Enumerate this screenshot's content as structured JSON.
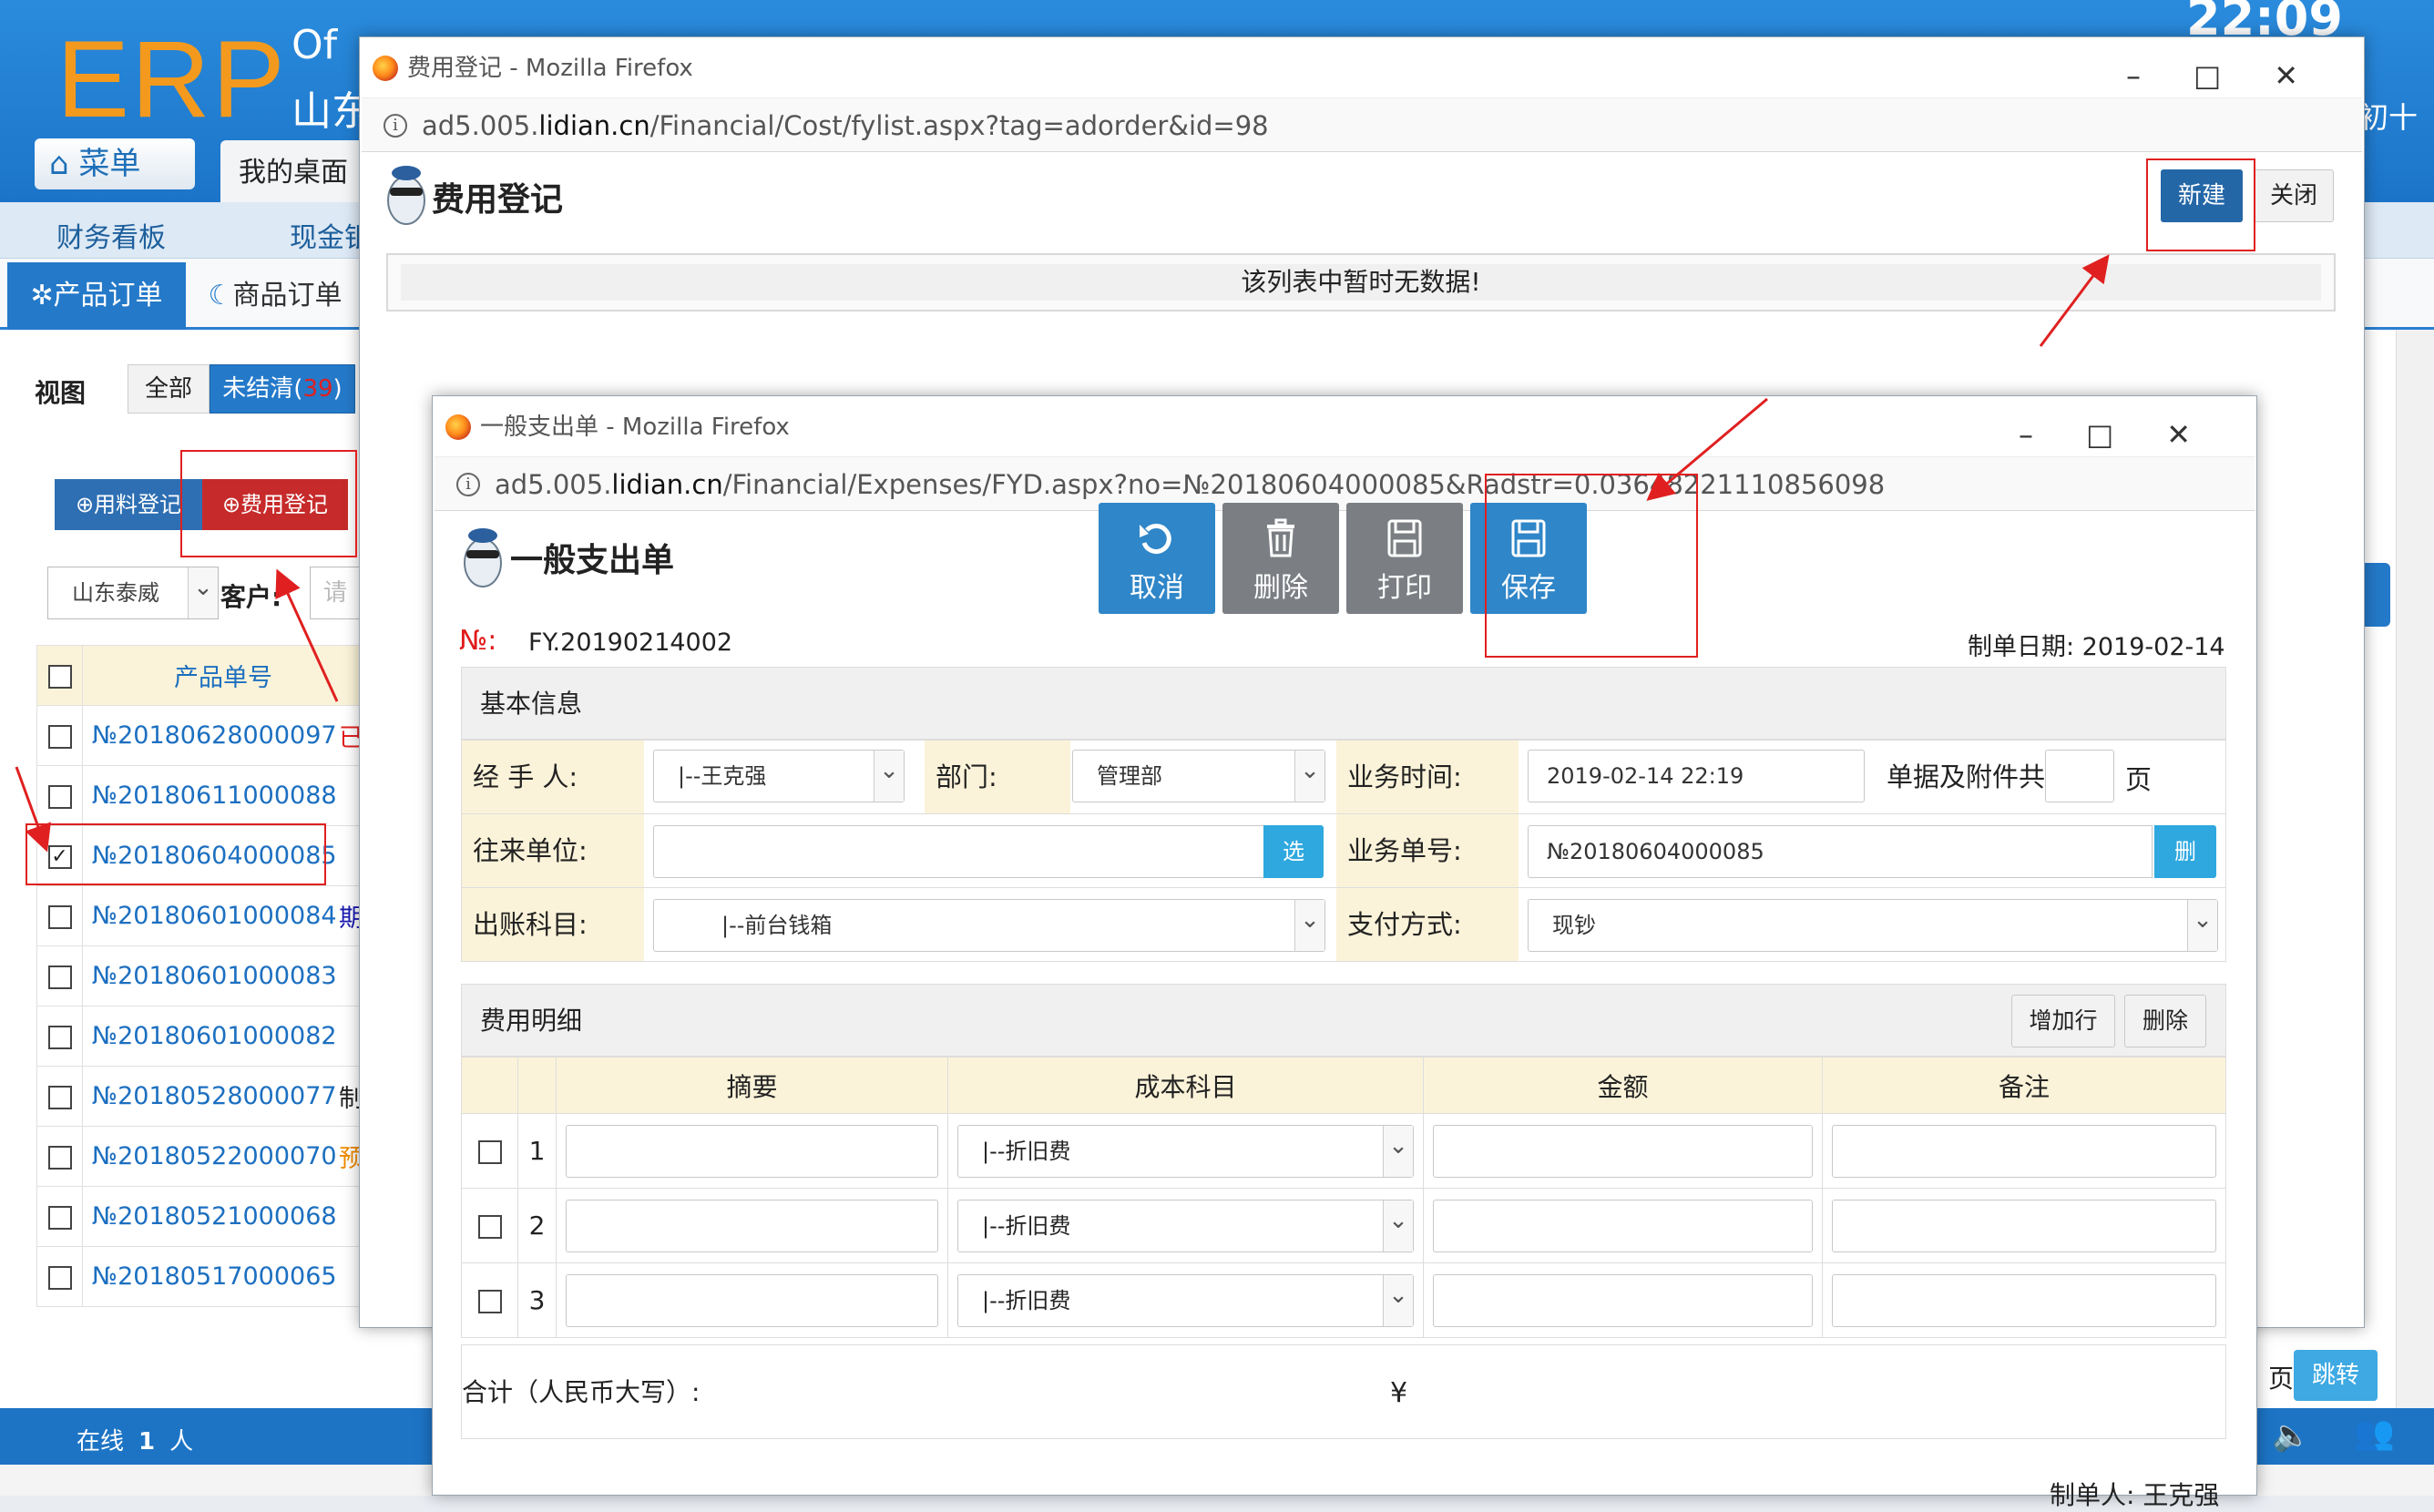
{
  "erp": {
    "logo": "ERP",
    "subtitle_line1": "Of",
    "subtitle_line2": "山东",
    "clock": "22:09",
    "lunar": "初十",
    "menu_button": "菜单",
    "desk_tab": "我的桌面",
    "nav": [
      "财务看板",
      "现金银"
    ],
    "tab_product": "产品订单",
    "tab_goods": "商品订单",
    "view_label": "视图",
    "view_all": "全部",
    "view_unsettled": "未结清(",
    "view_unsettled_count": "39",
    "view_unsettled_tail": ")",
    "btn_material": "用料登记",
    "btn_expense": "费用登记",
    "company": "山东泰威",
    "customer_label": "客户:",
    "customer_placeholder": "请",
    "list_header": "产品单号",
    "rows": [
      {
        "no": "№20180628000097",
        "checked": false,
        "tail": "已",
        "tail_color": "#e02020"
      },
      {
        "no": "№20180611000088",
        "checked": false,
        "tail": "",
        "tail_color": "#222"
      },
      {
        "no": "№20180604000085",
        "checked": true,
        "tail": "",
        "tail_color": "#222"
      },
      {
        "no": "№20180601000084",
        "checked": false,
        "tail": "期",
        "tail_color": "#1a1ab0"
      },
      {
        "no": "№20180601000083",
        "checked": false,
        "tail": "",
        "tail_color": "#222"
      },
      {
        "no": "№20180601000082",
        "checked": false,
        "tail": "",
        "tail_color": "#222"
      },
      {
        "no": "№20180528000077",
        "checked": false,
        "tail": "制",
        "tail_color": "#222"
      },
      {
        "no": "№20180522000070",
        "checked": false,
        "tail": "预",
        "tail_color": "#f08a00"
      },
      {
        "no": "№20180521000068",
        "checked": false,
        "tail": "",
        "tail_color": "#222"
      },
      {
        "no": "№20180517000065",
        "checked": false,
        "tail": "",
        "tail_color": "#222"
      }
    ],
    "online_label": "在线",
    "online_count": "1",
    "online_unit": "人",
    "page_suffix": "页",
    "jump_button": "跳转"
  },
  "window1": {
    "title": "费用登记 - Mozilla Firefox",
    "url_prefix": "ad5.005.",
    "url_domain": "lidian.cn",
    "url_path": "/Financial/Cost/fylist.aspx?tag=adorder&id=98",
    "page_title": "费用登记",
    "new_button": "新建",
    "close_button": "关闭",
    "empty_message": "该列表中暂时无数据!"
  },
  "window2": {
    "title": "一般支出单 - Mozilla Firefox",
    "url_prefix": "ad5.005.",
    "url_domain": "lidian.cn",
    "url_path": "/Financial/Expenses/FYD.aspx?no=№20180604000085&Radstr=0.03648221110856098",
    "page_title": "一般支出单",
    "toolbar": {
      "cancel": "取消",
      "delete": "删除",
      "print": "打印",
      "save": "保存"
    },
    "doc_no_label": "№:",
    "doc_no": "FY.20190214002",
    "doc_date": "制单日期: 2019-02-14",
    "basic_section": "基本信息",
    "fields": {
      "handler_label": "经 手 人:",
      "handler_value": "|--王克强",
      "dept_label": "部门:",
      "dept_value": "管理部",
      "biz_time_label": "业务时间:",
      "biz_time_value": "2019-02-14 22:19",
      "attach_label": "单据及附件共",
      "attach_value": "",
      "attach_unit": "页",
      "partner_label": "往来单位:",
      "partner_value": "",
      "partner_btn": "选",
      "biz_no_label": "业务单号:",
      "biz_no_value": "№20180604000085",
      "biz_no_btn": "删",
      "account_label": "出账科目:",
      "account_value": "|--前台钱箱",
      "pay_label": "支付方式:",
      "pay_value": "现钞"
    },
    "detail_section": "费用明细",
    "add_row_button": "增加行",
    "delete_row_button": "删除",
    "detail_headers": [
      "摘要",
      "成本科目",
      "金额",
      "备注"
    ],
    "detail_rows": [
      {
        "index": "1",
        "cost_item": "|--折旧费"
      },
      {
        "index": "2",
        "cost_item": "|--折旧费"
      },
      {
        "index": "3",
        "cost_item": "|--折旧费"
      }
    ],
    "total_label": "合计（人民币大写）:",
    "total_symbol": "¥",
    "maker": "制单人: 王克强"
  },
  "colors": {
    "erp_blue": "#1d74c5",
    "accent_orange": "#f39a1e",
    "annotation_red": "#e02020",
    "save_blue": "#2f86c8"
  }
}
